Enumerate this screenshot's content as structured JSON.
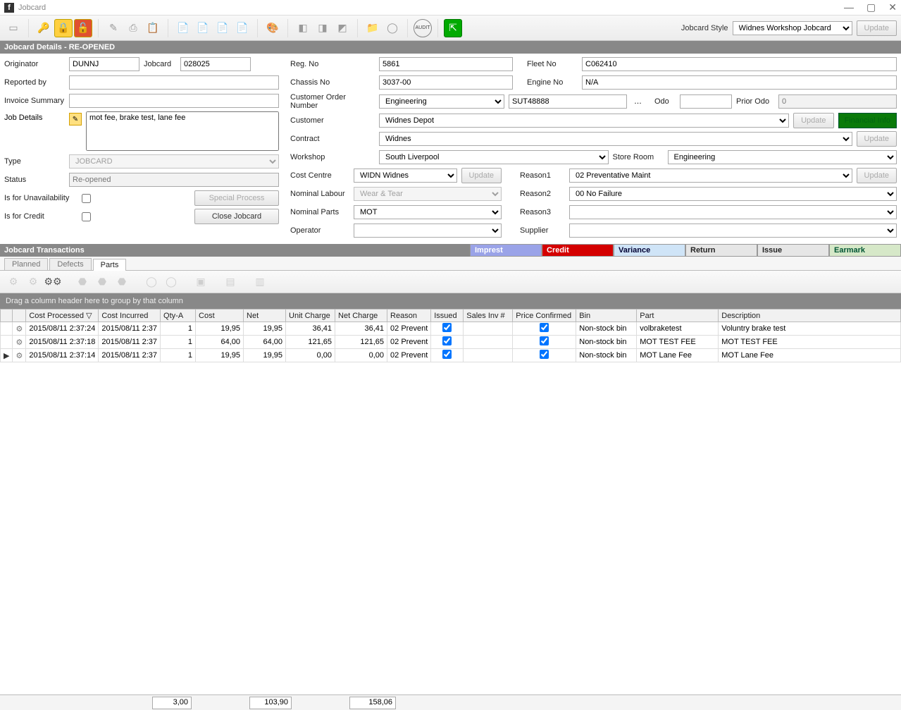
{
  "window": {
    "title": "Jobcard"
  },
  "toolbar_right": {
    "label": "Jobcard Style",
    "style": "Widnes Workshop Jobcard",
    "update_label": "Update"
  },
  "section_title": "Jobcard Details - RE-OPENED",
  "labels": {
    "originator": "Originator",
    "jobcard": "Jobcard",
    "reported_by": "Reported by",
    "invoice_summary": "Invoice Summary",
    "job_details": "Job Details",
    "type": "Type",
    "status": "Status",
    "is_for_unavail": "Is for Unavailability",
    "is_for_credit": "Is for Credit",
    "special_process": "Special Process",
    "close_jobcard": "Close Jobcard",
    "reg_no": "Reg. No",
    "chassis_no": "Chassis No",
    "cust_order_no": "Customer Order Number",
    "customer": "Customer",
    "contract": "Contract",
    "workshop": "Workshop",
    "store_room": "Store Room",
    "cost_centre": "Cost Centre",
    "nominal_labour": "Nominal Labour",
    "nominal_parts": "Nominal Parts",
    "operator": "Operator",
    "fleet_no": "Fleet No",
    "engine_no": "Engine No",
    "odo": "Odo",
    "prior_odo": "Prior Odo",
    "reason1": "Reason1",
    "reason2": "Reason2",
    "reason3": "Reason3",
    "supplier": "Supplier",
    "update": "Update",
    "financial": "Financial Info"
  },
  "values": {
    "originator": "DUNNJ",
    "jobcard": "028025",
    "reported_by": "",
    "invoice_summary": "",
    "job_details": "mot fee, brake test, lane fee",
    "type": "JOBCARD",
    "status": "Re-opened",
    "is_for_unavail": false,
    "is_for_credit": false,
    "reg_no": "5861",
    "chassis_no": "3037-00",
    "cust_order_no_cat": "Engineering",
    "cust_order_no_val": "SUT48888",
    "customer": "Widnes Depot",
    "contract": "Widnes",
    "workshop": "South Liverpool",
    "store_room": "Engineering",
    "cost_centre": "WIDN Widnes",
    "nominal_labour": "Wear & Tear",
    "nominal_parts": "MOT",
    "operator": "",
    "fleet_no": "C062410",
    "engine_no": "N/A",
    "odo": "",
    "prior_odo": "0",
    "reason1": "02 Preventative Maint",
    "reason2": "00 No Failure",
    "reason3": "",
    "supplier": ""
  },
  "trans_section_title": "Jobcard Transactions",
  "trans_cells": {
    "imprest": "Imprest",
    "credit": "Credit",
    "variance": "Variance",
    "return": "Return",
    "issue": "Issue",
    "earmark": "Earmark"
  },
  "tabs": {
    "planned": "Planned",
    "defects": "Defects",
    "parts": "Parts"
  },
  "group_bar_text": "Drag a column header here to group by that column",
  "grid": {
    "cols": [
      "Cost Processed",
      "Cost Incurred",
      "Qty-A",
      "Cost",
      "Net",
      "Unit Charge",
      "Net Charge",
      "Reason",
      "Issued",
      "Sales Inv #",
      "Price Confirmed",
      "Bin",
      "Part",
      "Description"
    ],
    "sort_indicator": "▽",
    "rows": [
      {
        "cost_processed": "2015/08/11 2:37:24",
        "cost_incurred": "2015/08/11 2:37",
        "qty": "1",
        "cost": "19,95",
        "net": "19,95",
        "unit_charge": "36,41",
        "net_charge": "36,41",
        "reason": "02 Prevent",
        "issued": true,
        "sales_inv": "",
        "price_conf": true,
        "bin": "Non-stock bin",
        "part": "volbraketest",
        "desc": "Voluntry brake test"
      },
      {
        "cost_processed": "2015/08/11 2:37:18",
        "cost_incurred": "2015/08/11 2:37",
        "qty": "1",
        "cost": "64,00",
        "net": "64,00",
        "unit_charge": "121,65",
        "net_charge": "121,65",
        "reason": "02 Prevent",
        "issued": true,
        "sales_inv": "",
        "price_conf": true,
        "bin": "Non-stock bin",
        "part": "MOT TEST FEE",
        "desc": "MOT TEST FEE"
      },
      {
        "cost_processed": "2015/08/11 2:37:14",
        "cost_incurred": "2015/08/11 2:37",
        "qty": "1",
        "cost": "19,95",
        "net": "19,95",
        "unit_charge": "0,00",
        "net_charge": "0,00",
        "reason": "02 Prevent",
        "issued": true,
        "sales_inv": "",
        "price_conf": true,
        "bin": "Non-stock bin",
        "part": "MOT Lane Fee",
        "desc": "MOT Lane Fee"
      }
    ]
  },
  "footer": {
    "qty": "3,00",
    "cost": "103,90",
    "charge": "158,06"
  }
}
